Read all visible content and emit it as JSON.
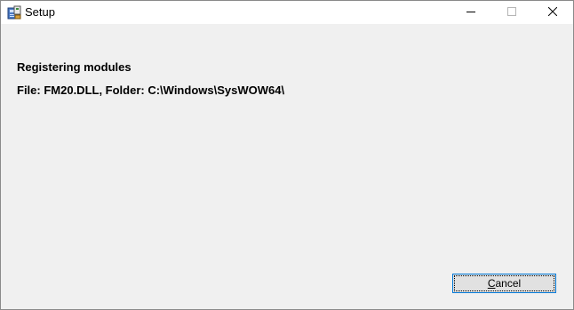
{
  "window": {
    "title": "Setup",
    "icon": "setup-installer-icon",
    "controls": {
      "minimize_icon": "minimize-icon",
      "maximize_icon": "maximize-icon",
      "close_icon": "close-icon"
    }
  },
  "status": {
    "title": "Registering modules",
    "detail": "File: FM20.DLL, Folder: C:\\Windows\\SysWOW64\\"
  },
  "buttons": {
    "cancel_accel": "C",
    "cancel_rest": "ancel"
  },
  "colors": {
    "window_bg": "#f0f0f0",
    "titlebar_bg": "#ffffff",
    "focus_border": "#0078d7"
  }
}
